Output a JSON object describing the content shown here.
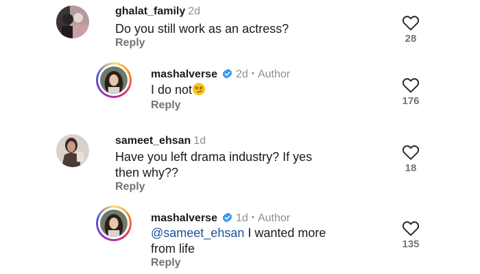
{
  "comments": [
    {
      "username": "ghalat_family",
      "time": "2d",
      "text": "Do you still work as an actress?",
      "reply_label": "Reply",
      "likes": "28",
      "verified": false,
      "author": ""
    },
    {
      "username": "mashalverse",
      "time": "2d",
      "author": "Author",
      "text": "I do not",
      "emoji": "smirking-face-emoji",
      "reply_label": "Reply",
      "likes": "176",
      "verified": true
    },
    {
      "username": "sameet_ehsan",
      "time": "1d",
      "text_line1": "Have you left drama industry? If yes",
      "text_line2": "then why??",
      "reply_label": "Reply",
      "likes": "18",
      "verified": false,
      "author": ""
    },
    {
      "username": "mashalverse",
      "time": "1d",
      "author": "Author",
      "mention": "@sameet_ehsan",
      "text_rest": " I wanted more",
      "text_line2": "from life",
      "reply_label": "Reply",
      "likes": "135",
      "verified": true
    }
  ],
  "separator": "•",
  "icons": {
    "like": "heart-outline-icon",
    "verified": "verified-badge-icon"
  },
  "colors": {
    "mention": "#1b4f9e",
    "verified": "#3897f0",
    "muted": "#737373"
  }
}
